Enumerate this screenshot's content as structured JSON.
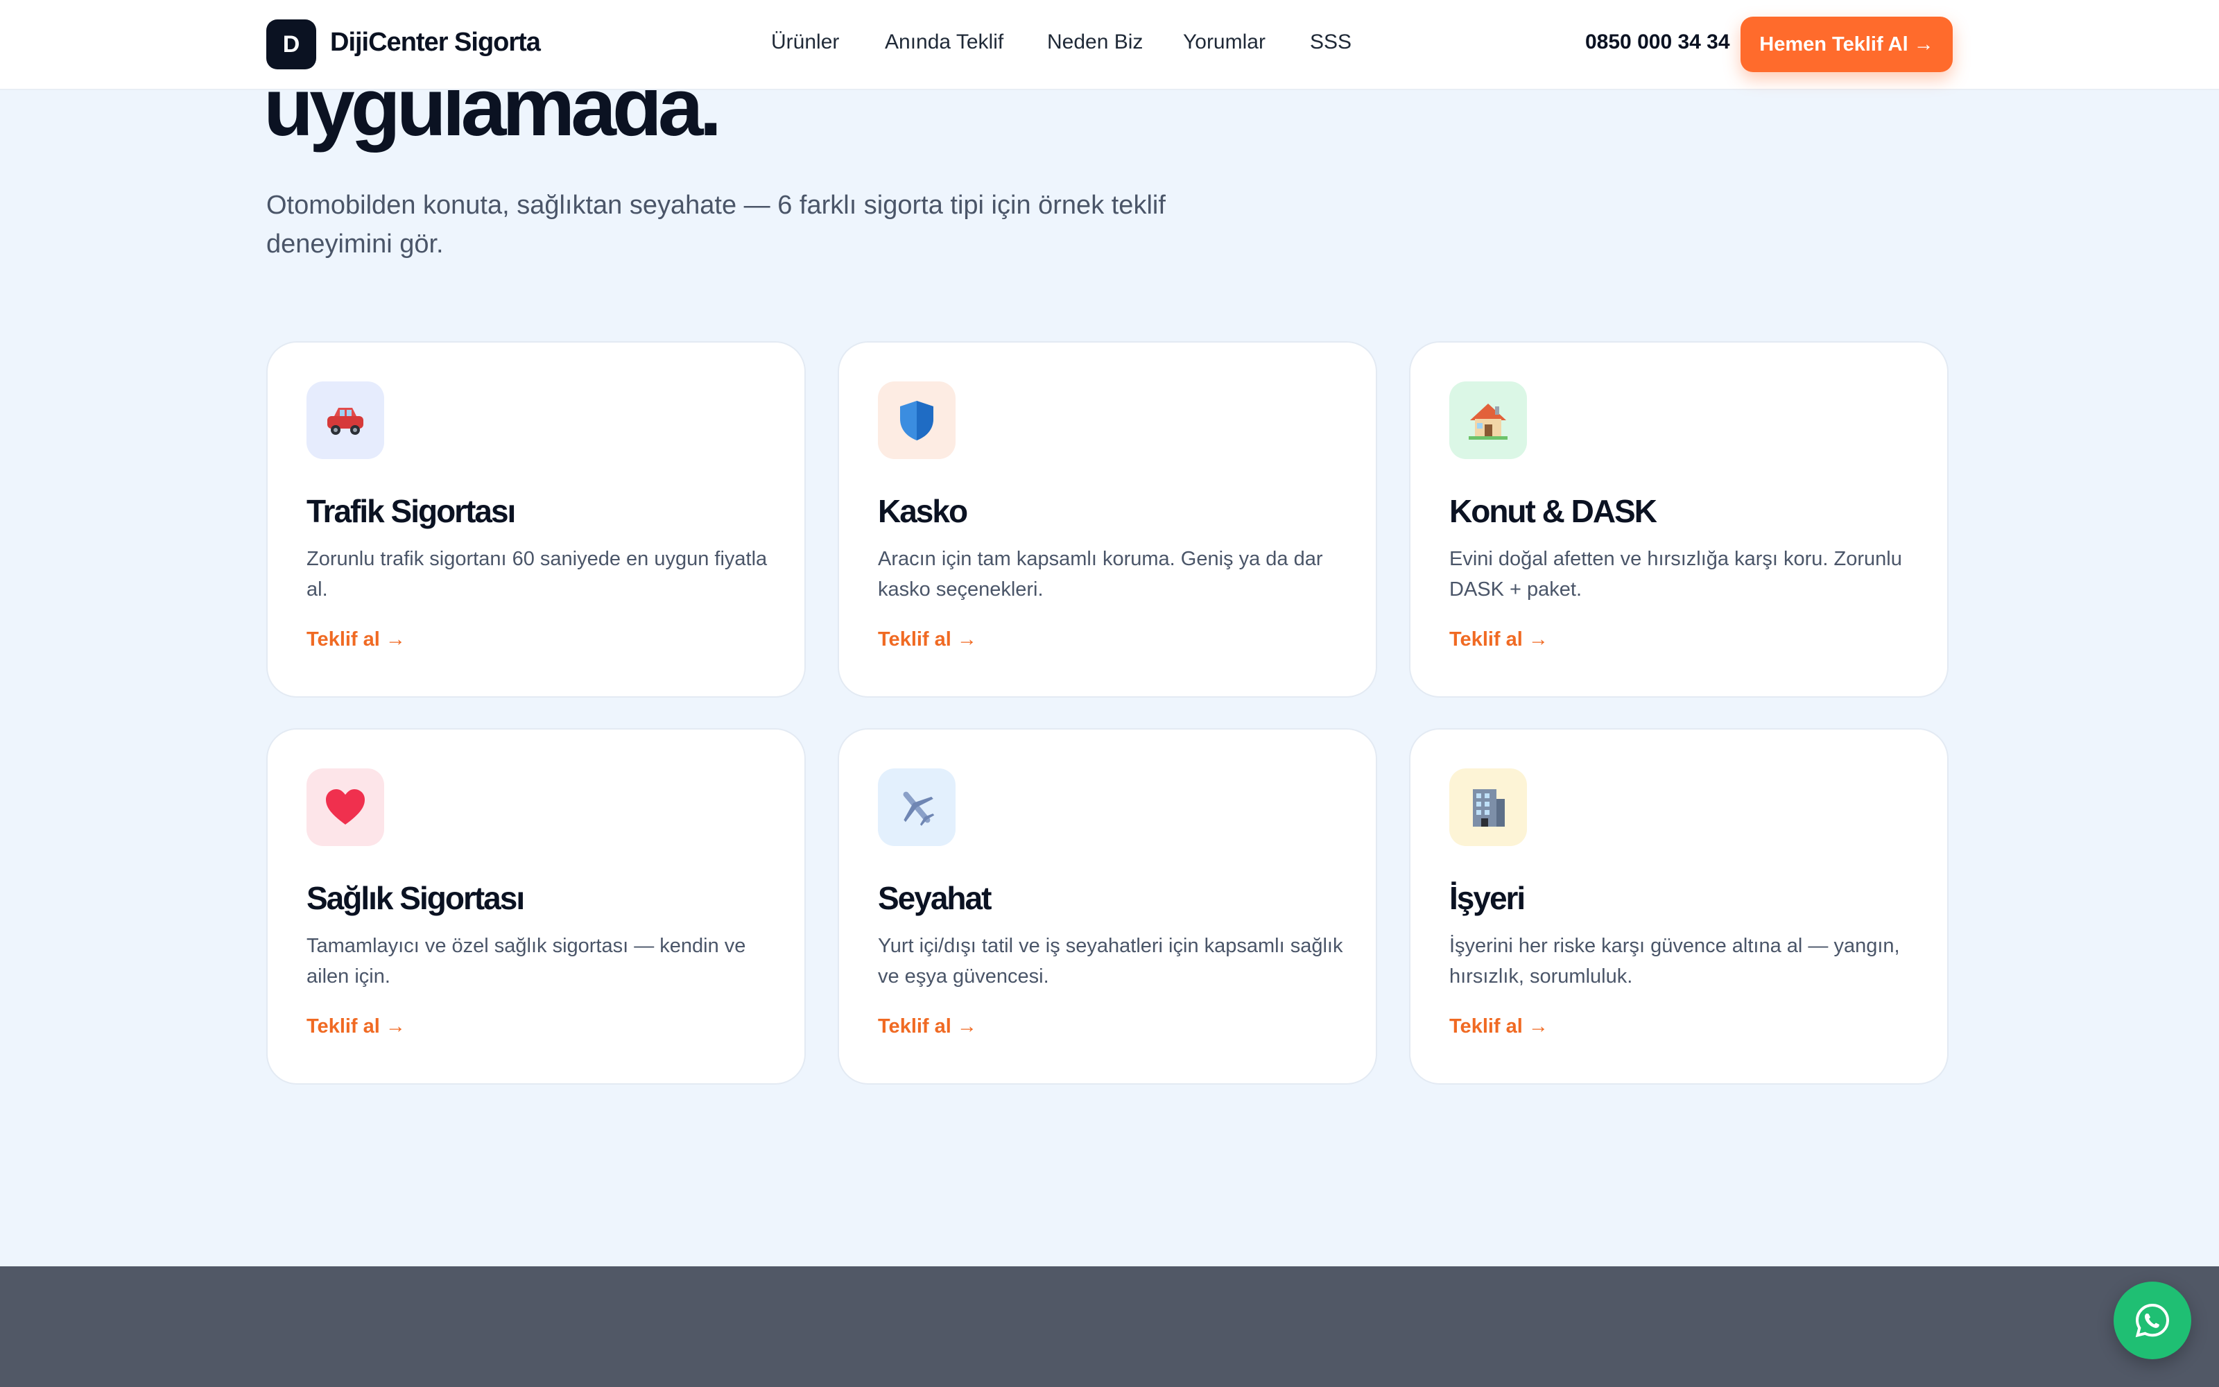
{
  "header": {
    "logo_letter": "D",
    "brand": "DijiCenter Sigorta",
    "nav": [
      "Ürünler",
      "Anında Teklif",
      "Neden Biz",
      "Yorumlar",
      "SSS"
    ],
    "phone": "0850 000 34 34",
    "cta": "Hemen Teklif Al →"
  },
  "hero": {
    "title_tail": "uygulamada.",
    "subtitle": "Otomobilden konuta, sağlıktan seyahate — 6 farklı sigorta tipi için örnek teklif deneyimini gör."
  },
  "cards": [
    {
      "title": "Trafik Sigortası",
      "desc": "Zorunlu trafik sigortanı 60 saniyede en uygun fiyatla al.",
      "link": "Teklif al →",
      "icon": "car-icon",
      "icon_bg": "#e6ecfd"
    },
    {
      "title": "Kasko",
      "desc": "Aracın için tam kapsamlı koruma. Geniş ya da dar kasko seçenekleri.",
      "link": "Teklif al →",
      "icon": "shield-icon",
      "icon_bg": "#fdece3"
    },
    {
      "title": "Konut & DASK",
      "desc": "Evini doğal afetten ve hırsızlığa karşı koru. Zorunlu DASK + paket.",
      "link": "Teklif al →",
      "icon": "house-icon",
      "icon_bg": "#dbf7e6"
    },
    {
      "title": "Sağlık Sigortası",
      "desc": "Tamamlayıcı ve özel sağlık sigortası — kendin ve ailen için.",
      "link": "Teklif al →",
      "icon": "heart-icon",
      "icon_bg": "#fde5e9"
    },
    {
      "title": "Seyahat",
      "desc": "Yurt içi/dışı tatil ve iş seyahatleri için kapsamlı sağlık ve eşya güvencesi.",
      "link": "Teklif al →",
      "icon": "airplane-icon",
      "icon_bg": "#e3f0fd"
    },
    {
      "title": "İşyeri",
      "desc": "İşyerini her riske karşı güvence altına al — yangın, hırsızlık, sorumluluk.",
      "link": "Teklif al →",
      "icon": "office-building-icon",
      "icon_bg": "#fdf4d6"
    }
  ],
  "colors": {
    "accent": "#ff6b2c",
    "link": "#f06a23",
    "brand_dark": "#0b1222",
    "whatsapp": "#1fbf73"
  }
}
